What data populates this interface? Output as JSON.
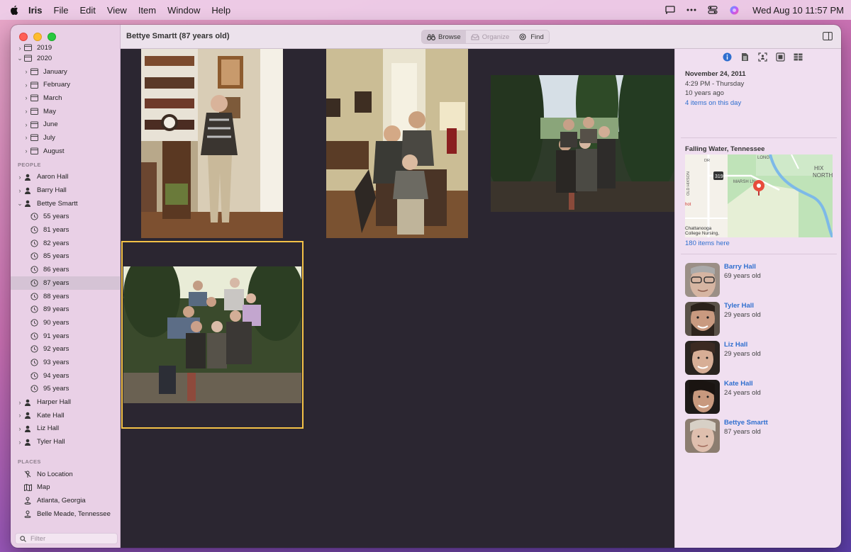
{
  "menubar": {
    "app": "Iris",
    "items": [
      "File",
      "Edit",
      "View",
      "Item",
      "Window",
      "Help"
    ],
    "clock": "Wed Aug 10  11:57 PM"
  },
  "window": {
    "title": "Bettye Smartt (87 years old)"
  },
  "toolbar": {
    "browse": "Browse",
    "organize": "Organize",
    "find": "Find"
  },
  "sidebar": {
    "years": [
      {
        "label": "2019",
        "expanded": false
      },
      {
        "label": "2020",
        "expanded": true
      }
    ],
    "months": [
      "January",
      "February",
      "March",
      "May",
      "June",
      "July",
      "August"
    ],
    "people_header": "PEOPLE",
    "people": [
      "Aaron Hall",
      "Barry Hall",
      "Bettye Smartt"
    ],
    "ages": [
      "55 years",
      "81 years",
      "82 years",
      "85 years",
      "86 years",
      "87 years",
      "88 years",
      "89 years",
      "90 years",
      "91 years",
      "92 years",
      "93 years",
      "94 years",
      "95 years"
    ],
    "selected_age": "87 years",
    "people_after": [
      "Harper Hall",
      "Kate Hall",
      "Liz Hall",
      "Tyler Hall"
    ],
    "places_header": "PLACES",
    "places": [
      "No Location",
      "Map",
      "Atlanta, Georgia",
      "Belle Meade, Tennessee"
    ],
    "filter_placeholder": "Filter"
  },
  "inspector": {
    "date": "November 24, 2011",
    "time": "4:29 PM - Thursday",
    "ago": "10 years ago",
    "items_on_day": "4 items on this day",
    "location": "Falling Water, Tennessee",
    "map_labels": {
      "road": "319",
      "street": "MARSH LN",
      "hix": "HIX",
      "north": "NORTH",
      "chatt": "Chattanooga",
      "nursing": "College Nursing,",
      "long": "LONG",
      "old": "OLD HIXSON",
      "dr": "DR",
      "hot": "hot"
    },
    "items_here": "180 items here",
    "people": [
      {
        "name": "Barry Hall",
        "age": "69 years old"
      },
      {
        "name": "Tyler Hall",
        "age": "29 years old"
      },
      {
        "name": "Liz Hall",
        "age": "29 years old"
      },
      {
        "name": "Kate Hall",
        "age": "24 years old"
      },
      {
        "name": "Bettye Smartt",
        "age": "87 years old"
      }
    ]
  },
  "colors": {
    "selection": "#f4c247",
    "link": "#2f6fcf",
    "grid_bg": "#2b2631"
  }
}
